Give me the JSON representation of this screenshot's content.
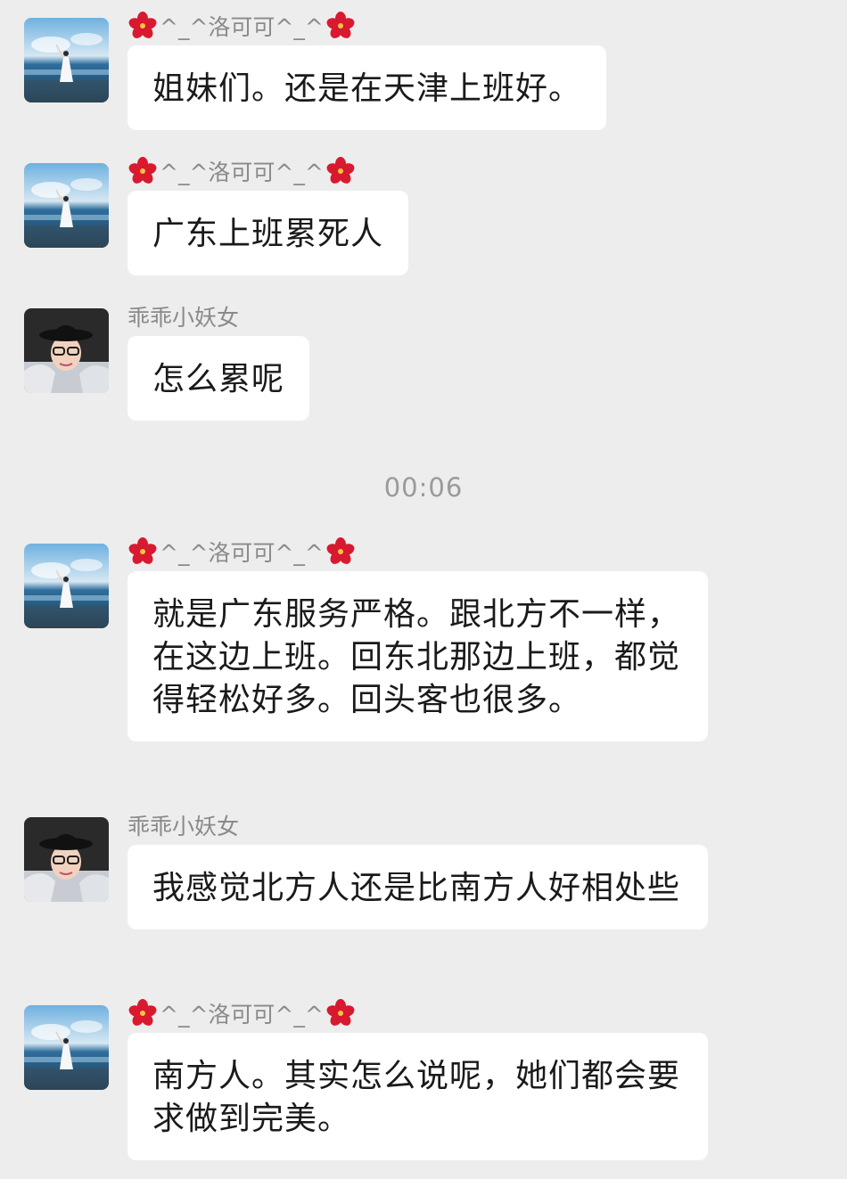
{
  "chat": {
    "timestamp": "00:06",
    "messages": [
      {
        "sender": "^_^洛可可^_^",
        "sender_decorated": true,
        "avatar": "beach-girl-avatar",
        "text": "姐妹们。还是在天津上班好。"
      },
      {
        "sender": "^_^洛可可^_^",
        "sender_decorated": true,
        "avatar": "beach-girl-avatar",
        "text": "广东上班累死人"
      },
      {
        "sender": "乖乖小妖女",
        "sender_decorated": false,
        "avatar": "hat-girl-avatar",
        "text": "怎么累呢"
      },
      {
        "sender": "^_^洛可可^_^",
        "sender_decorated": true,
        "avatar": "beach-girl-avatar",
        "text": "就是广东服务严格。跟北方不一样，在这边上班。回东北那边上班，都觉得轻松好多。回头客也很多。"
      },
      {
        "sender": "乖乖小妖女",
        "sender_decorated": false,
        "avatar": "hat-girl-avatar",
        "text": "我感觉北方人还是比南方人好相处些"
      },
      {
        "sender": "^_^洛可可^_^",
        "sender_decorated": true,
        "avatar": "beach-girl-avatar",
        "text": "南方人。其实怎么说呢，她们都会要求做到完美。"
      }
    ]
  },
  "colors": {
    "background": "#ededed",
    "bubble": "#ffffff",
    "sender_name": "#8a8a8a",
    "timestamp": "#9a9a9a",
    "flower": "#d8192f"
  },
  "icons": {
    "sender_decoration": "hibiscus-flower-icon"
  }
}
